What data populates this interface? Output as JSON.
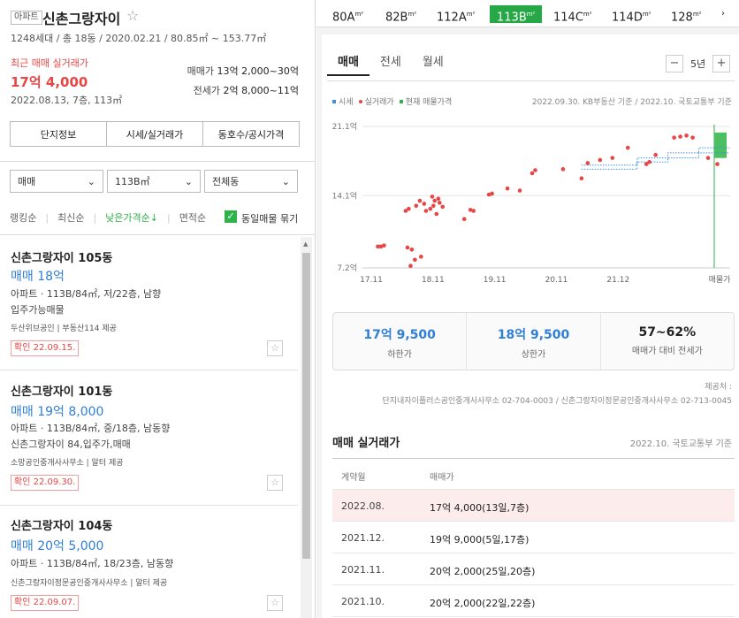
{
  "complex": {
    "type_badge": "아파트",
    "name": "신촌그랑자이",
    "meta": "1248세대 / 총 18동 / 2020.02.21 / 80.85㎡ ~ 153.77㎡",
    "recent_label": "최근 매매 실거래가",
    "recent_price": "17억 4,000",
    "recent_meta": "2022.08.13, 7층, 113㎡",
    "sale_label": "매매가",
    "sale_range": "13억 2,000~30억",
    "jeonse_label": "전세가",
    "jeonse_range": "2억 8,000~11억",
    "tabs": [
      "단지정보",
      "시세/실거래가",
      "동호수/공시가격"
    ]
  },
  "filters": {
    "trade_type": "매매",
    "size": "113B㎡",
    "dong": "전체동"
  },
  "sort": {
    "items": [
      "랭킹순",
      "최신순",
      "낮은가격순↓",
      "면적순"
    ],
    "active_index": 2,
    "group_label": "동일매물 묶기"
  },
  "listings": [
    {
      "title": "신촌그랑자이 105동",
      "price": "매매 18억",
      "desc1": "아파트 · 113B/84㎡, 저/22층, 남향",
      "desc2": "입주가능매물",
      "agency": "두산위브공인 | 부동산114 제공",
      "badge": "확인 22.09.15."
    },
    {
      "title": "신촌그랑자이 101동",
      "price": "매매 19억 8,000",
      "desc1": "아파트 · 113B/84㎡, 중/18층, 남동향",
      "desc2": "신촌그랑자이 84,입주가,매매",
      "agency": "소망공인중개사사무소 | 알터 제공",
      "badge": "확인 22.09.30."
    },
    {
      "title": "신촌그랑자이 104동",
      "price": "매매 20억 5,000",
      "desc1": "아파트 · 113B/84㎡, 18/23층, 남동향",
      "desc2": "",
      "agency": "신촌그랑자이정문공인중개사사무소 | 알터 제공",
      "badge": "확인 22.09.07."
    }
  ],
  "sizes": [
    {
      "label": "80A",
      "unit": "m²"
    },
    {
      "label": "82B",
      "unit": "m²"
    },
    {
      "label": "112A",
      "unit": "m²"
    },
    {
      "label": "113B",
      "unit": "m²"
    },
    {
      "label": "114C",
      "unit": "m²"
    },
    {
      "label": "114D",
      "unit": "m²"
    },
    {
      "label": "128",
      "unit": "m²"
    }
  ],
  "active_size_index": 3,
  "tabs": [
    "매매",
    "전세",
    "월세"
  ],
  "active_tab_index": 0,
  "period": {
    "label": "5년",
    "minus": "−",
    "plus": "+"
  },
  "legend": {
    "market": "시세",
    "actual": "실거래가",
    "listing": "현재 매물가격",
    "market_color": "#3b8fe0",
    "actual_color": "#e84545",
    "listing_color": "#2eb24a"
  },
  "basis": "2022.09.30. KB부동산 기준 / 2022.10. 국토교통부 기준",
  "chart_data": {
    "type": "scatter",
    "y_ticks": [
      "21.1억",
      "14.1억",
      "7.2억"
    ],
    "x_ticks": [
      "17.11",
      "18.11",
      "19.11",
      "20.11",
      "21.12",
      "매물가"
    ],
    "ylim": [
      7.2,
      21.1
    ],
    "actual_points": [
      [
        0.0,
        9.3
      ],
      [
        0.05,
        9.3
      ],
      [
        0.1,
        9.4
      ],
      [
        0.45,
        12.8
      ],
      [
        0.5,
        13.0
      ],
      [
        0.48,
        9.2
      ],
      [
        0.55,
        9.0
      ],
      [
        0.53,
        7.4
      ],
      [
        0.6,
        8.0
      ],
      [
        0.7,
        8.3
      ],
      [
        0.62,
        13.3
      ],
      [
        0.68,
        13.8
      ],
      [
        0.78,
        12.8
      ],
      [
        0.75,
        13.5
      ],
      [
        0.85,
        13.0
      ],
      [
        0.88,
        14.2
      ],
      [
        0.9,
        13.3
      ],
      [
        0.92,
        13.8
      ],
      [
        0.95,
        12.5
      ],
      [
        0.98,
        14.0
      ],
      [
        1.0,
        13.6
      ],
      [
        1.05,
        13.2
      ],
      [
        1.4,
        12.0
      ],
      [
        1.5,
        12.9
      ],
      [
        1.55,
        12.8
      ],
      [
        1.8,
        14.4
      ],
      [
        1.85,
        14.5
      ],
      [
        2.1,
        15.0
      ],
      [
        2.3,
        14.8
      ],
      [
        2.5,
        16.5
      ],
      [
        2.55,
        16.8
      ],
      [
        3.0,
        16.9
      ],
      [
        3.3,
        16.0
      ],
      [
        3.4,
        17.5
      ],
      [
        3.6,
        17.8
      ],
      [
        3.8,
        18.0
      ],
      [
        4.05,
        19.0
      ],
      [
        4.35,
        17.4
      ],
      [
        4.4,
        17.6
      ],
      [
        4.5,
        18.3
      ],
      [
        4.8,
        20.0
      ],
      [
        4.9,
        20.1
      ],
      [
        5.0,
        20.2
      ],
      [
        5.1,
        20.0
      ],
      [
        5.35,
        18.0
      ],
      [
        5.5,
        17.4
      ]
    ],
    "market_upper": [
      [
        3.3,
        17.3
      ],
      [
        4.2,
        17.3
      ],
      [
        4.2,
        18.0
      ],
      [
        4.7,
        18.0
      ],
      [
        4.7,
        18.5
      ],
      [
        5.2,
        18.5
      ],
      [
        5.2,
        19.0
      ],
      [
        5.7,
        19.0
      ]
    ],
    "market_lower": [
      [
        3.3,
        16.9
      ],
      [
        4.2,
        16.9
      ],
      [
        4.2,
        17.6
      ],
      [
        4.7,
        17.6
      ],
      [
        4.7,
        18.0
      ],
      [
        5.2,
        18.0
      ],
      [
        5.2,
        18.5
      ],
      [
        5.7,
        18.5
      ]
    ],
    "listing_range": [
      18.0,
      20.5
    ]
  },
  "stats": [
    {
      "value": "17억 9,500",
      "label": "하한가"
    },
    {
      "value": "18억 9,500",
      "label": "상한가"
    },
    {
      "value": "57~62%",
      "label": "매매가 대비 전세가"
    }
  ],
  "source": {
    "title": "제공처 :",
    "text": "단지내자이플러스공인중개사사무소 02-704-0003 / 신촌그랑자이정문공인중개사사무소 02-713-0045"
  },
  "deals": {
    "title": "매매 실거래가",
    "basis": "2022.10. 국토교통부 기준",
    "headers": [
      "계약월",
      "매매가"
    ],
    "rows": [
      {
        "month": "2022.08.",
        "price": "17억 4,000(13일,7층)"
      },
      {
        "month": "2021.12.",
        "price": "19억 9,000(5일,17층)"
      },
      {
        "month": "2021.11.",
        "price": "20억 2,000(25일,20층)"
      },
      {
        "month": "2021.10.",
        "price": "20억 2,000(22일,22층)"
      }
    ]
  }
}
